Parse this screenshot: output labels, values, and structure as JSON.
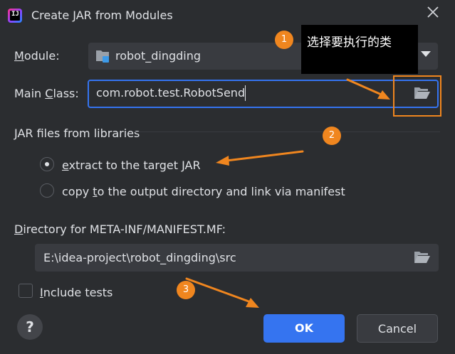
{
  "dialog": {
    "title": "Create JAR from Modules",
    "app_icon_text": "IJ"
  },
  "module": {
    "label_prefix": "",
    "label_mnemonic": "M",
    "label_rest": "odule:",
    "value": "robot_dingding"
  },
  "main_class": {
    "label_before": "Main ",
    "label_mnemonic": "C",
    "label_after": "lass:",
    "value": "com.robot.test.RobotSend"
  },
  "libraries": {
    "section_title": "JAR files from libraries",
    "option_extract": {
      "mnemonic": "e",
      "rest": "xtract to the target JAR",
      "selected": true
    },
    "option_copy": {
      "before": "copy ",
      "mnemonic": "t",
      "after": "o the output directory and link via manifest",
      "selected": false
    }
  },
  "manifest": {
    "label_mnemonic": "D",
    "label_rest": "irectory for META-INF/MANIFEST.MF:",
    "value": "E:\\idea-project\\robot_dingding\\src"
  },
  "include_tests": {
    "mnemonic": "I",
    "rest": "nclude tests",
    "checked": false
  },
  "buttons": {
    "help": "?",
    "ok": "OK",
    "cancel": "Cancel"
  },
  "annotations": {
    "step1": "1",
    "step2": "2",
    "step3": "3",
    "tooltip": "选择要执行的类",
    "color": "#f0861f"
  },
  "colors": {
    "background": "#2b2d30",
    "accent": "#3574f0",
    "field": "#393b40"
  }
}
